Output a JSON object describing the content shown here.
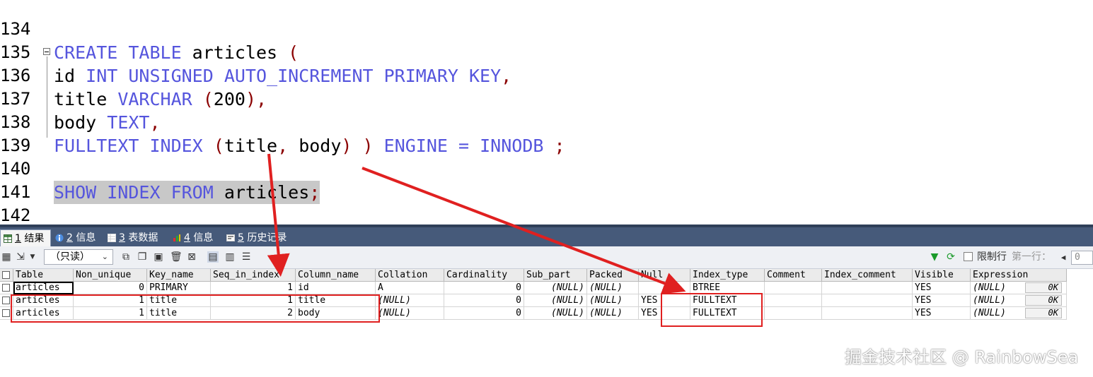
{
  "editor": {
    "lines": [
      {
        "num": "134"
      },
      {
        "num": "135"
      },
      {
        "num": "136",
        "t1": "CREATE TABLE",
        "t2": " articles ",
        "t3": "("
      },
      {
        "num": "137",
        "t1": "id ",
        "t2": "INT UNSIGNED AUTO_INCREMENT PRIMARY KEY",
        "t3": ","
      },
      {
        "num": "138",
        "t1": "title ",
        "t2": "VARCHAR",
        "t3": " (",
        "t4": "200",
        "t5": "),"
      },
      {
        "num": "139",
        "t1": "body ",
        "t2": "TEXT",
        "t3": ","
      },
      {
        "num": "140",
        "t1": "FULLTEXT INDEX",
        "t2": " (",
        "t3": "title",
        "t4": ", ",
        "t5": "body",
        "t6": ") ) ",
        "t7": "ENGINE",
        "t8": " = ",
        "t9": "INNODB",
        "t10": " ;"
      },
      {
        "num": "141"
      },
      {
        "num": "142",
        "t1": "SHOW INDEX FROM",
        "t2": " articles",
        "t3": ";"
      }
    ]
  },
  "tabs": [
    {
      "num": "1",
      "label": "结果",
      "icon": "grid-icon"
    },
    {
      "num": "2",
      "label": "信息",
      "icon": "info-icon"
    },
    {
      "num": "3",
      "label": "表数据",
      "icon": "table-icon"
    },
    {
      "num": "4",
      "label": "信息",
      "icon": "info-icon"
    },
    {
      "num": "5",
      "label": "历史记录",
      "icon": "history-icon"
    }
  ],
  "toolbar": {
    "mode_select": "（只读）",
    "limit_label": "限制行",
    "first_row_label": "第一行：",
    "first_row_value": "0"
  },
  "grid": {
    "headers": [
      "Table",
      "Non_unique",
      "Key_name",
      "Seq_in_index",
      "Column_name",
      "Collation",
      "Cardinality",
      "Sub_part",
      "Packed",
      "Null",
      "Index_type",
      "Comment",
      "Index_comment",
      "Visible",
      "Expression"
    ],
    "rows": [
      [
        "articles",
        "0",
        "PRIMARY",
        "1",
        "id",
        "A",
        "0",
        "(NULL)",
        "(NULL)",
        "",
        "BTREE",
        "",
        "",
        "YES",
        "(NULL)"
      ],
      [
        "articles",
        "1",
        "title",
        "1",
        "title",
        "(NULL)",
        "0",
        "(NULL)",
        "(NULL)",
        "YES",
        "FULLTEXT",
        "",
        "",
        "YES",
        "(NULL)"
      ],
      [
        "articles",
        "1",
        "title",
        "2",
        "body",
        "(NULL)",
        "0",
        "(NULL)",
        "(NULL)",
        "YES",
        "FULLTEXT",
        "",
        "",
        "YES",
        "(NULL)"
      ]
    ],
    "row_size_label": "0K"
  },
  "watermark": "掘金技术社区 @ RainbowSea",
  "colors": {
    "keyword": "#5555dd",
    "punct": "#8b0000",
    "annotation": "#e02020",
    "tabbar": "#465a7a"
  }
}
